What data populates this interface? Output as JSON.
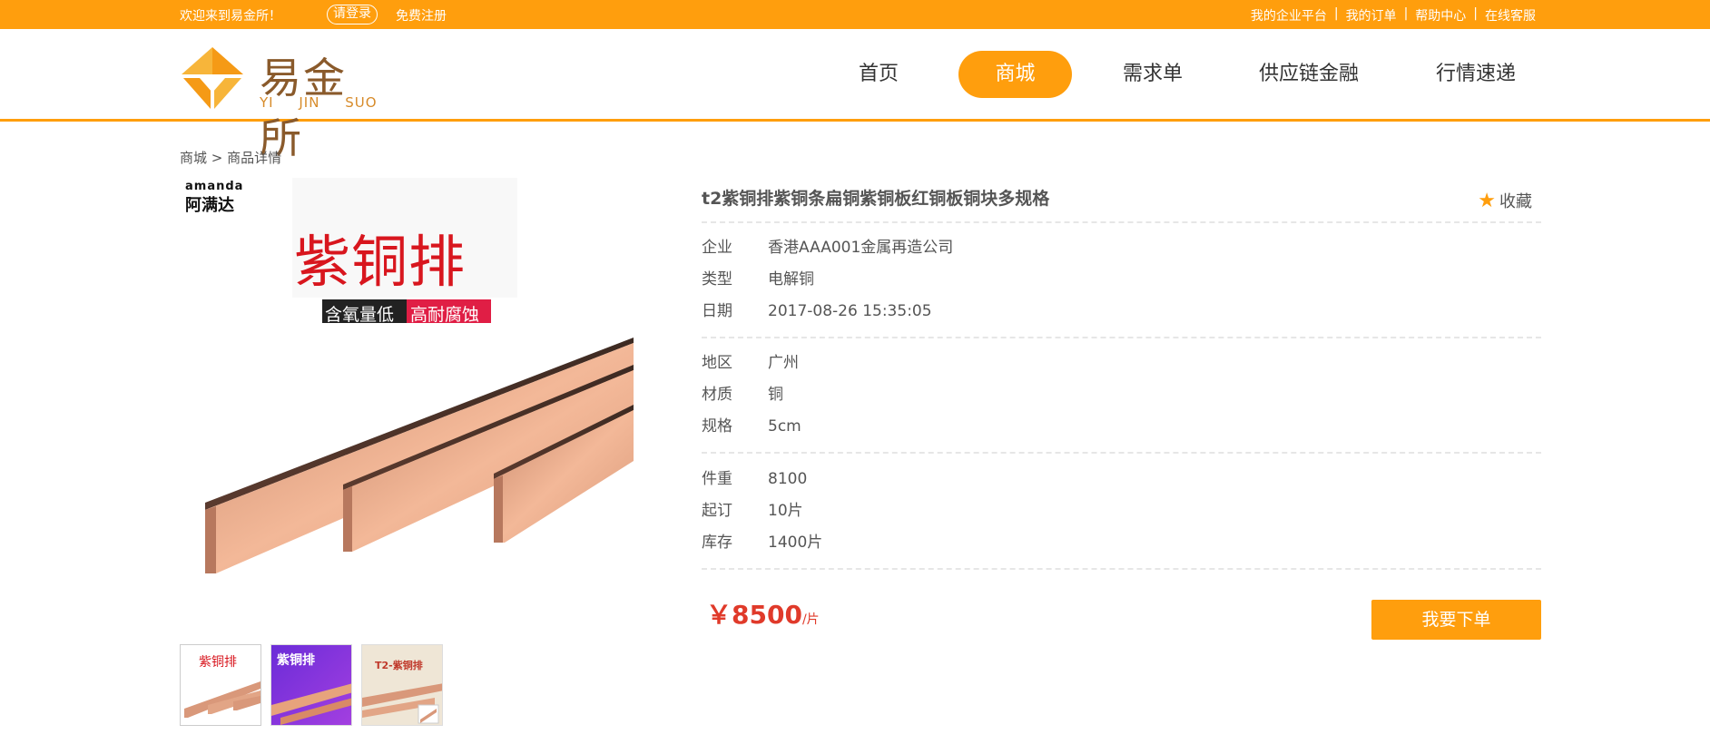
{
  "topbar": {
    "welcome": "欢迎来到易金所！",
    "login": "请登录",
    "register": "免费注册",
    "links": [
      "我的企业平台",
      "我的订单",
      "帮助中心",
      "在线客服"
    ],
    "separator": "|"
  },
  "logo": {
    "text": "易金所",
    "sub": "YI JIN SUO"
  },
  "nav": [
    "首页",
    "商城",
    "需求单",
    "供应链金融",
    "行情速递"
  ],
  "breadcrumb": "商城 > 商品详情",
  "product": {
    "image_brand": "amanda",
    "image_brand_cn": "阿满达",
    "image_heading": "紫铜排",
    "image_tag1": "含氧量低",
    "image_tag2": "高耐腐蚀",
    "title": "t2紫铜排紫铜条扁铜紫铜板红铜板铜块多规格",
    "favorite": "收藏",
    "group1": [
      {
        "k": "企业",
        "v": "香港AAA001金属再造公司"
      },
      {
        "k": "类型",
        "v": "电解铜"
      },
      {
        "k": "日期",
        "v": "2017-08-26 15:35:05"
      }
    ],
    "group2": [
      {
        "k": "地区",
        "v": "广州"
      },
      {
        "k": "材质",
        "v": "铜"
      },
      {
        "k": "规格",
        "v": "5cm"
      }
    ],
    "group3": [
      {
        "k": "件重",
        "v": "8100"
      },
      {
        "k": "起订",
        "v": "10片"
      },
      {
        "k": "库存",
        "v": "1400片"
      }
    ],
    "price_currency": "￥",
    "price": "8500",
    "price_unit": "/片",
    "order_button": "我要下单"
  },
  "thumbs": [
    {
      "label": "紫铜排"
    },
    {
      "label": "紫铜排"
    },
    {
      "label": "T2-紫铜排"
    }
  ],
  "colors": {
    "accent": "#ff9e0d",
    "price": "#e03a2a",
    "copper": "#d9987a"
  }
}
